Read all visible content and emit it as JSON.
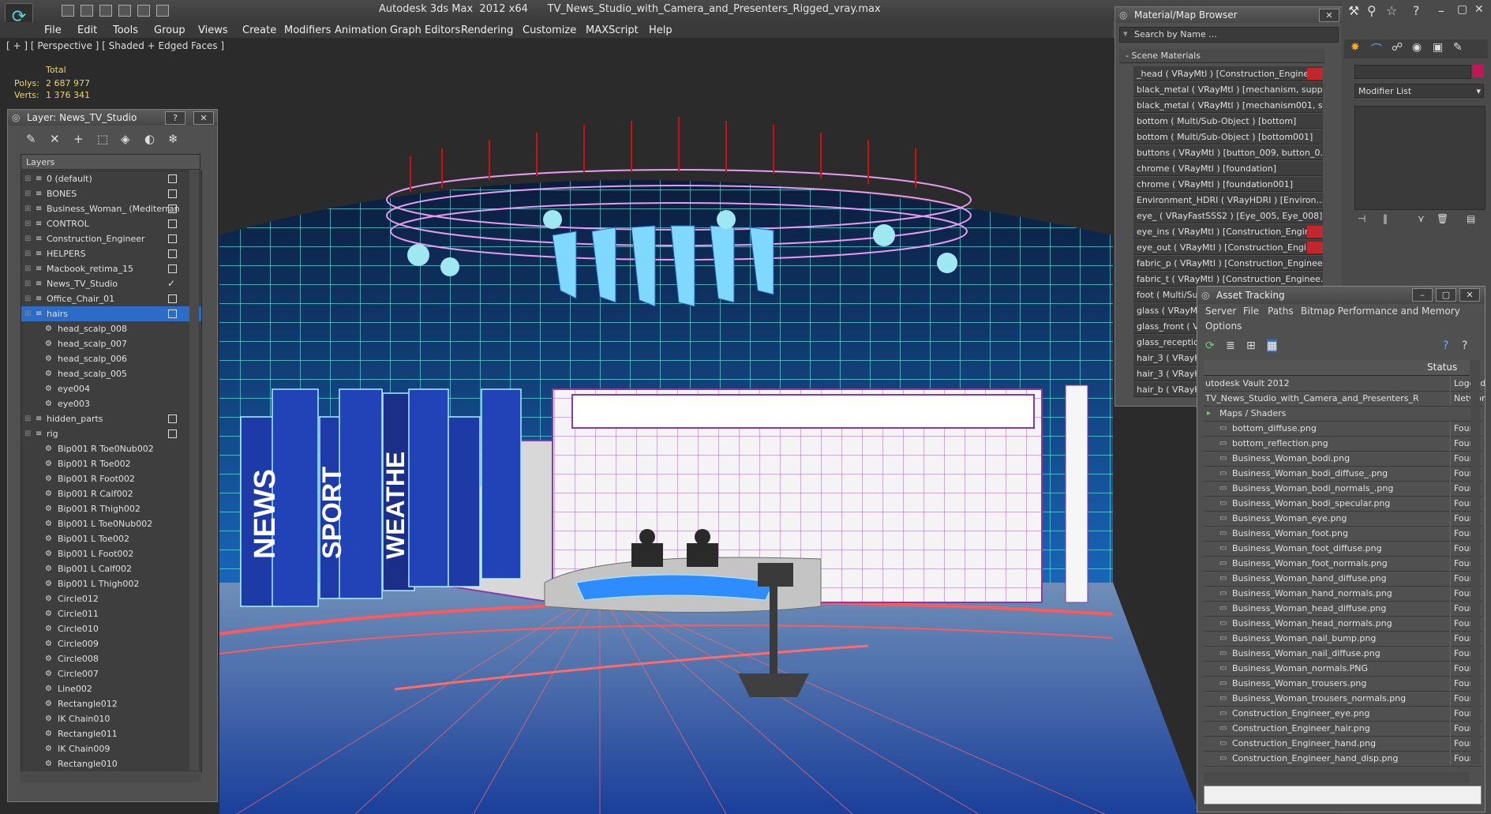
{
  "app": {
    "title": "Autodesk 3ds Max  2012 x64      TV_News_Studio_with_Camera_and_Presenters_Rigged_vray.max",
    "menu": [
      "File",
      "Edit",
      "Tools",
      "Group",
      "Views",
      "Create",
      "Modifiers",
      "Animation",
      "Graph Editors",
      "Rendering",
      "Customize",
      "MAXScript",
      "Help"
    ]
  },
  "viewport": {
    "label": "[ + ] [ Perspective ] [ Shaded + Edged Faces ]",
    "stats_total": "Total",
    "polys_label": "Polys:",
    "polys_value": "2 687 977",
    "verts_label": "Verts:",
    "verts_value": "1 376 341",
    "sign_news": "NEWS",
    "sign_sport": "SPORT",
    "sign_weather": "WEATHE"
  },
  "layer_panel": {
    "title": "Layer: News_TV_Studio",
    "help_btn": "?",
    "close_btn": "✕",
    "column": "Layers",
    "rows": [
      {
        "label": "0 (default)",
        "level": 0,
        "checked": false,
        "selected": false
      },
      {
        "label": "BONES",
        "level": 0,
        "checked": false,
        "selected": false
      },
      {
        "label": "Business_Woman_ (Mediterran",
        "level": 0,
        "checked": false,
        "selected": false
      },
      {
        "label": "CONTROL",
        "level": 0,
        "checked": false,
        "selected": false
      },
      {
        "label": "Construction_Engineer",
        "level": 0,
        "checked": false,
        "selected": false
      },
      {
        "label": "HELPERS",
        "level": 0,
        "checked": false,
        "selected": false
      },
      {
        "label": "Macbook_retima_15",
        "level": 0,
        "checked": false,
        "selected": false
      },
      {
        "label": "News_TV_Studio",
        "level": 0,
        "checked": true,
        "selected": false
      },
      {
        "label": "Office_Chair_01",
        "level": 0,
        "checked": false,
        "selected": false
      },
      {
        "label": "hairs",
        "level": 0,
        "checked": false,
        "selected": true
      },
      {
        "label": "head_scalp_008",
        "level": 1
      },
      {
        "label": "head_scalp_007",
        "level": 1
      },
      {
        "label": "head_scalp_006",
        "level": 1
      },
      {
        "label": "head_scalp_005",
        "level": 1
      },
      {
        "label": "eye004",
        "level": 1
      },
      {
        "label": "eye003",
        "level": 1
      },
      {
        "label": "hidden_parts",
        "level": 0,
        "checked": false,
        "selected": false
      },
      {
        "label": "rig",
        "level": 0,
        "checked": false,
        "selected": false
      },
      {
        "label": "Bip001 R Toe0Nub002",
        "level": 1
      },
      {
        "label": "Bip001 R Toe002",
        "level": 1
      },
      {
        "label": "Bip001 R Foot002",
        "level": 1
      },
      {
        "label": "Bip001 R Calf002",
        "level": 1
      },
      {
        "label": "Bip001 R Thigh002",
        "level": 1
      },
      {
        "label": "Bip001 L Toe0Nub002",
        "level": 1
      },
      {
        "label": "Bip001 L Toe002",
        "level": 1
      },
      {
        "label": "Bip001 L Foot002",
        "level": 1
      },
      {
        "label": "Bip001 L Calf002",
        "level": 1
      },
      {
        "label": "Bip001 L Thigh002",
        "level": 1
      },
      {
        "label": "Circle012",
        "level": 1
      },
      {
        "label": "Circle011",
        "level": 1
      },
      {
        "label": "Circle010",
        "level": 1
      },
      {
        "label": "Circle009",
        "level": 1
      },
      {
        "label": "Circle008",
        "level": 1
      },
      {
        "label": "Circle007",
        "level": 1
      },
      {
        "label": "Line002",
        "level": 1
      },
      {
        "label": "Rectangle012",
        "level": 1
      },
      {
        "label": "IK Chain010",
        "level": 1
      },
      {
        "label": "Rectangle011",
        "level": 1
      },
      {
        "label": "IK Chain009",
        "level": 1
      },
      {
        "label": "Rectangle010",
        "level": 1
      }
    ]
  },
  "material_browser": {
    "title": "Material/Map Browser",
    "search_placeholder": "Search by Name ...",
    "section": "Scene Materials",
    "rows": [
      {
        "label": "_head  ( VRayMtl )  [Construction_Engineer_...",
        "flag": true
      },
      {
        "label": "black_metal  ( VRayMtl )  [mechanism, supp...",
        "flag": false
      },
      {
        "label": "black_metal  ( VRayMtl )  [mechanism001, s...",
        "flag": false
      },
      {
        "label": "bottom  ( Multi/Sub-Object )  [bottom]",
        "flag": false
      },
      {
        "label": "bottom  ( Multi/Sub-Object )  [bottom001]",
        "flag": false
      },
      {
        "label": "buttons  ( VRayMtl )  [button_009, button_0...",
        "flag": false
      },
      {
        "label": "chrome  ( VRayMtl )  [foundation]",
        "flag": false
      },
      {
        "label": "chrome  ( VRayMtl )  [foundation001]",
        "flag": false
      },
      {
        "label": "Environment_HDRI  ( VRayHDRI )  [Environ...",
        "flag": false
      },
      {
        "label": "eye_  ( VRayFastSSS2 )  [Eye_005, Eye_008]",
        "flag": false
      },
      {
        "label": "eye_ins  ( VRayMtl )  [Construction_Engineer...",
        "flag": true
      },
      {
        "label": "eye_out  ( VRayMtl )  [Construction_Enginee...",
        "flag": true
      },
      {
        "label": "fabric_p  ( VRayMtl )  [Construction_Enginee...",
        "flag": false
      },
      {
        "label": "fabric_t  ( VRayMtl )  [Construction_Enginee...",
        "flag": false
      },
      {
        "label": "foot  ( Multi/Su",
        "flag": false
      },
      {
        "label": "glass  ( VRayM",
        "flag": false
      },
      {
        "label": "glass_front  ( V",
        "flag": false
      },
      {
        "label": "glass_reception",
        "flag": false
      },
      {
        "label": "hair_3  ( VRayH",
        "flag": false
      },
      {
        "label": "hair_3  ( VRayH",
        "flag": false
      },
      {
        "label": "hair_b  ( VRayH",
        "flag": false
      }
    ]
  },
  "asset_tracking": {
    "title": "Asset Tracking",
    "menus": [
      "Server",
      "File",
      "Paths",
      "Bitmap Performance and Memory",
      "Options"
    ],
    "status_header": "Status",
    "vault_row": {
      "name": "utodesk Vault 2012",
      "status": "Logged C"
    },
    "file_row": {
      "name": "TV_News_Studio_with_Camera_and_Presenters_Ri...",
      "status": "Network"
    },
    "group_row": {
      "name": "Maps / Shaders",
      "status": ""
    },
    "files": [
      {
        "name": "bottom_diffuse.png",
        "status": "Found"
      },
      {
        "name": "bottom_reflection.png",
        "status": "Found"
      },
      {
        "name": "Business_Woman_bodi.png",
        "status": "Found"
      },
      {
        "name": "Business_Woman_bodi_diffuse_.png",
        "status": "Found"
      },
      {
        "name": "Business_Woman_bodi_normals_.png",
        "status": "Found"
      },
      {
        "name": "Business_Woman_bodi_specular.png",
        "status": "Found"
      },
      {
        "name": "Business_Woman_eye.png",
        "status": "Found"
      },
      {
        "name": "Business_Woman_foot.png",
        "status": "Found"
      },
      {
        "name": "Business_Woman_foot_diffuse.png",
        "status": "Found"
      },
      {
        "name": "Business_Woman_foot_normals.png",
        "status": "Found"
      },
      {
        "name": "Business_Woman_hand_diffuse.png",
        "status": "Found"
      },
      {
        "name": "Business_Woman_hand_normals.png",
        "status": "Found"
      },
      {
        "name": "Business_Woman_head_diffuse.png",
        "status": "Found"
      },
      {
        "name": "Business_Woman_head_normals.png",
        "status": "Found"
      },
      {
        "name": "Business_Woman_nail_bump.png",
        "status": "Found"
      },
      {
        "name": "Business_Woman_nail_diffuse.png",
        "status": "Found"
      },
      {
        "name": "Business_Woman_normals.PNG",
        "status": "Found"
      },
      {
        "name": "Business_Woman_trousers.png",
        "status": "Found"
      },
      {
        "name": "Business_Woman_trousers_normals.png",
        "status": "Found"
      },
      {
        "name": "Construction_Engineer_eye.png",
        "status": "Found"
      },
      {
        "name": "Construction_Engineer_hair.png",
        "status": "Found"
      },
      {
        "name": "Construction_Engineer_hand.png",
        "status": "Found"
      },
      {
        "name": "Construction_Engineer_hand_disp.png",
        "status": "Found"
      }
    ]
  },
  "command_panel": {
    "modifier_list": "Modifier List"
  },
  "colors": {
    "selection": "#2d6cc6",
    "flag_red": "#c4262e",
    "stat_yellow": "#e8d76a",
    "wire_cyan": "#5fe8e0",
    "wire_magenta": "#d47ee8"
  }
}
